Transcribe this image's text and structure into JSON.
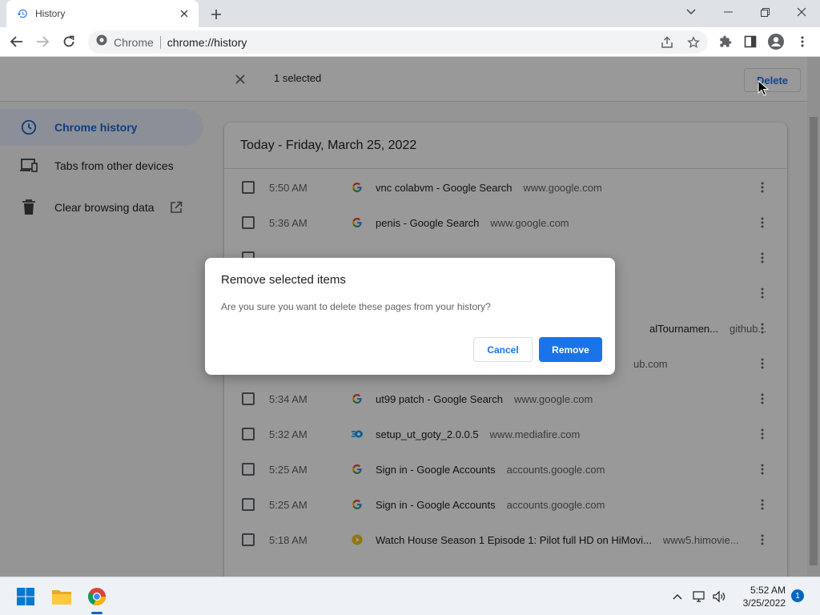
{
  "tab": {
    "title": "History"
  },
  "toolbar": {
    "site_name": "Chrome",
    "url": "chrome://history"
  },
  "selection_bar": {
    "count_text": "1 selected",
    "delete_label": "Delete"
  },
  "sidebar": {
    "items": [
      {
        "label": "Chrome history",
        "icon": "clock-icon",
        "active": true
      },
      {
        "label": "Tabs from other devices",
        "icon": "devices-icon",
        "active": false
      },
      {
        "label": "Clear browsing data",
        "icon": "trash-icon",
        "active": false
      }
    ]
  },
  "history": {
    "date_header": "Today - Friday, March 25, 2022",
    "rows": [
      {
        "time": "5:50 AM",
        "favicon": "google-icon",
        "title": "vnc colabvm - Google Search",
        "domain": "www.google.com"
      },
      {
        "time": "5:36 AM",
        "favicon": "google-icon",
        "title": "penis - Google Search",
        "domain": "www.google.com"
      },
      {
        "time": "",
        "favicon": "",
        "title": "",
        "domain": ""
      },
      {
        "time": "",
        "favicon": "",
        "title": "",
        "domain": ""
      },
      {
        "time": "",
        "favicon": "",
        "title": "alTournamen...",
        "domain": "github..."
      },
      {
        "time": "",
        "favicon": "",
        "title": "ub.com",
        "domain": ""
      },
      {
        "time": "5:34 AM",
        "favicon": "google-icon",
        "title": "ut99 patch - Google Search",
        "domain": "www.google.com"
      },
      {
        "time": "5:32 AM",
        "favicon": "mediafire-icon",
        "title": "setup_ut_goty_2.0.0.5",
        "domain": "www.mediafire.com"
      },
      {
        "time": "5:25 AM",
        "favicon": "google-icon",
        "title": "Sign in - Google Accounts",
        "domain": "accounts.google.com"
      },
      {
        "time": "5:25 AM",
        "favicon": "google-icon",
        "title": "Sign in - Google Accounts",
        "domain": "accounts.google.com"
      },
      {
        "time": "5:18 AM",
        "favicon": "himovies-icon",
        "title": "Watch House Season 1 Episode 1: Pilot full HD on HiMovi...",
        "domain": "www5.himovie..."
      }
    ]
  },
  "dialog": {
    "title": "Remove selected items",
    "body": "Are you sure you want to delete these pages from your history?",
    "cancel_label": "Cancel",
    "remove_label": "Remove"
  },
  "taskbar": {
    "time": "5:52 AM",
    "date": "3/25/2022",
    "notification_count": "1"
  },
  "colors": {
    "accent": "#1a73e8",
    "active_bg": "#e8f0fe",
    "google_blue": "#4285f4"
  }
}
